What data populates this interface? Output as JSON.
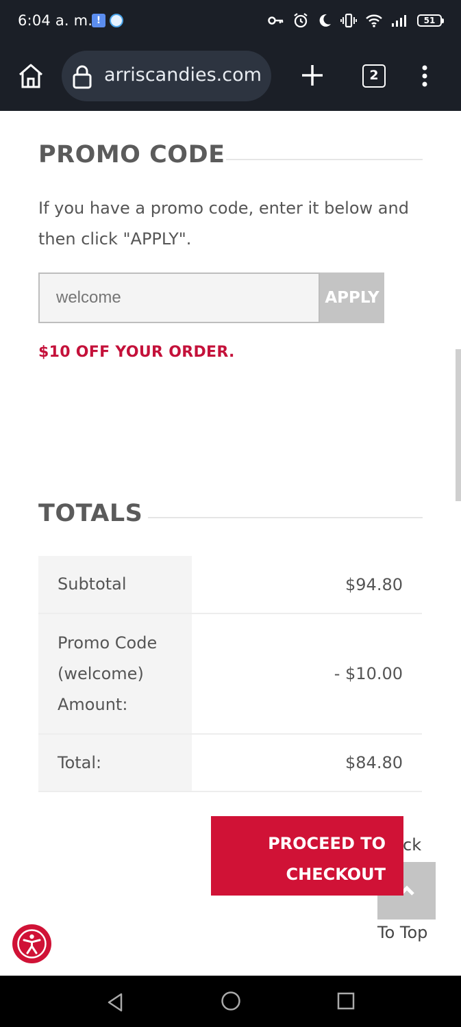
{
  "status_bar": {
    "time": "6:04 a. m.",
    "battery": "51"
  },
  "browser": {
    "url": "arriscandies.com",
    "tab_count": "2"
  },
  "promo": {
    "title": "PROMO CODE",
    "description": "If you have a promo code, enter it below and then click \"APPLY\".",
    "input_placeholder": "welcome",
    "apply_label": "APPLY",
    "message": "$10 OFF YOUR ORDER."
  },
  "totals": {
    "title": "TOTALS",
    "rows": [
      {
        "label": "Subtotal",
        "value": "$94.80"
      },
      {
        "label": "Promo Code (welcome) Amount:",
        "value": "- $10.00"
      },
      {
        "label": "Total:",
        "value": "$84.80"
      }
    ]
  },
  "actions": {
    "checkout_label": "PROCEED TO CHECKOUT",
    "back_partial": "ck",
    "to_top_label": "To Top"
  },
  "colors": {
    "accent_red": "#d01236",
    "bar_dark": "#1b1f27"
  }
}
